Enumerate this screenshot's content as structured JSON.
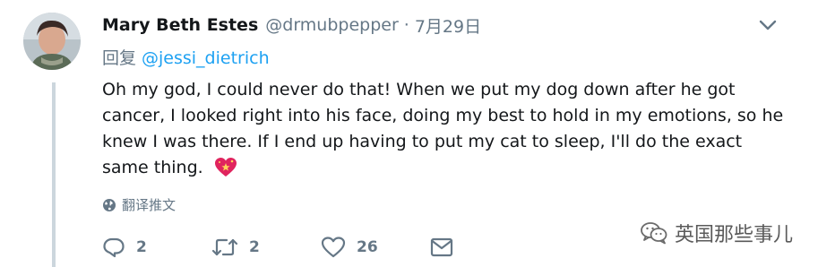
{
  "author": {
    "display_name": "Mary Beth Estes",
    "handle": "@drmubpepper",
    "separator": "·",
    "date": "7月29日"
  },
  "reply": {
    "prefix": "回复",
    "mention": "@jessi_dietrich"
  },
  "tweet": {
    "text": "Oh my god, I could never do that! When we put my dog down after he got cancer, I looked right into his face, doing my best to hold in my emotions, so he knew I was there. If I end up having to put my cat to sleep, I'll do the exact same thing.",
    "emoji": "sparkling-heart"
  },
  "translate_label": "翻译推文",
  "actions": {
    "reply_count": "2",
    "retweet_count": "2",
    "like_count": "26"
  },
  "watermark": "英国那些事儿",
  "colors": {
    "primary_text": "#14171a",
    "secondary_text": "#657786",
    "link": "#1da1f2",
    "thread_line": "#ccd6dd"
  },
  "icons": [
    "chevron-down-icon",
    "globe-icon",
    "reply-icon",
    "retweet-icon",
    "like-icon",
    "message-icon",
    "wechat-icon"
  ]
}
